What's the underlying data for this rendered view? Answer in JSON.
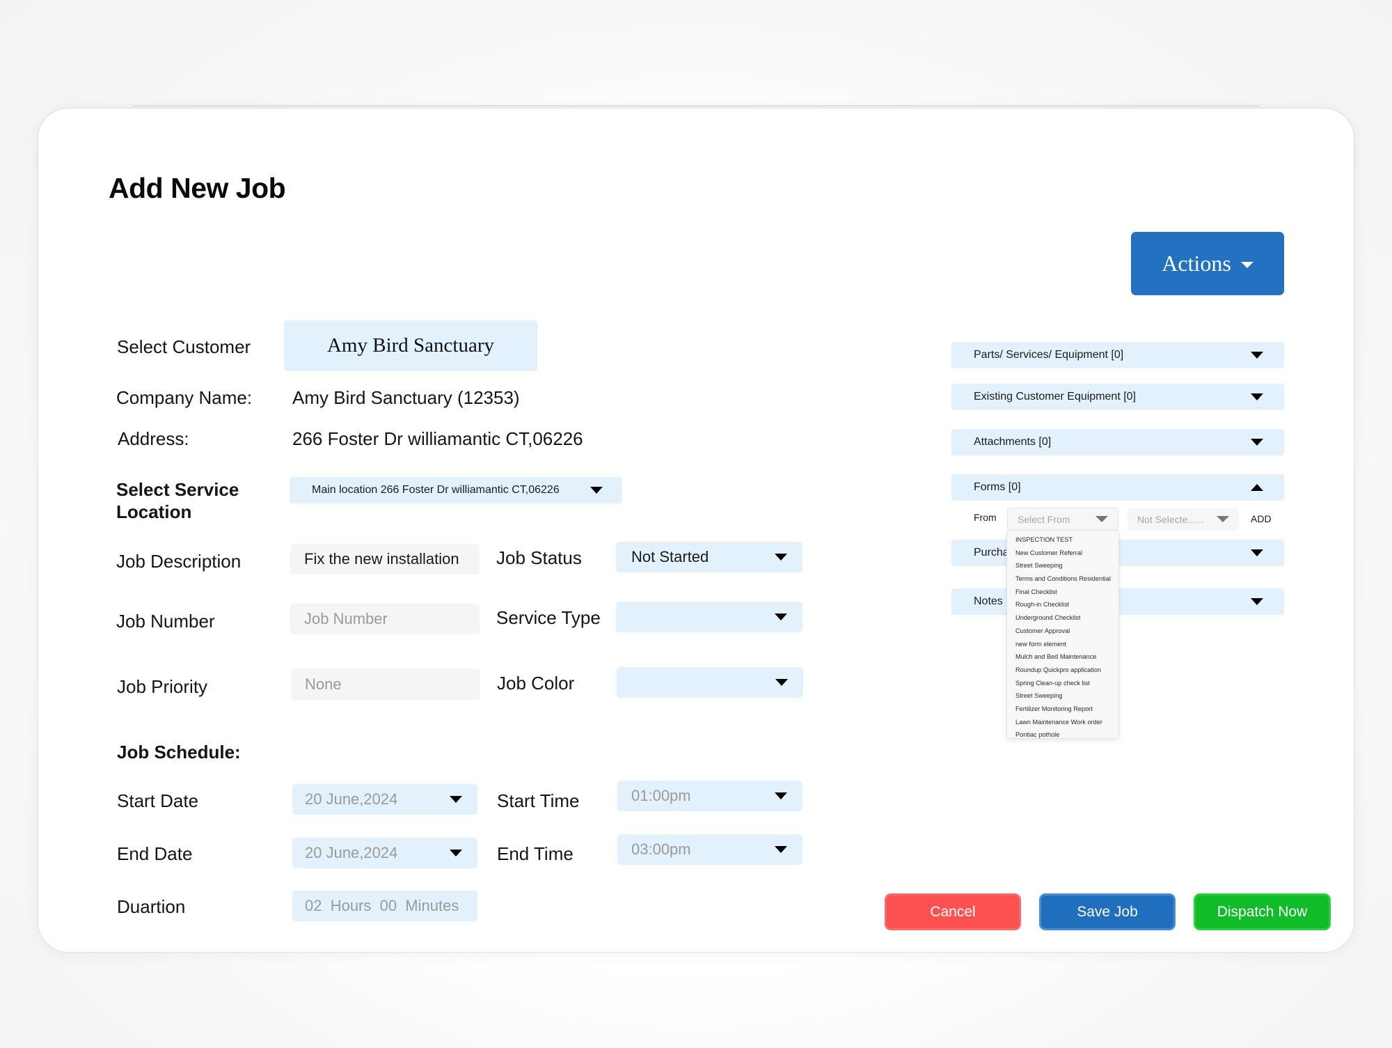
{
  "dialog": {
    "title": "Add New Job",
    "actions_label": "Actions"
  },
  "customer": {
    "select_label": "Select Customer",
    "selected": "Amy Bird Sanctuary",
    "company_label": "Company Name:",
    "company_value": "Amy Bird Sanctuary (12353)",
    "address_label": "Address:",
    "address_value": "266 Foster Dr williamantic CT,06226"
  },
  "service_location": {
    "label_line1": "Select Service",
    "label_line2": "Location",
    "value": "Main location 266 Foster Dr williamantic CT,06226"
  },
  "job": {
    "description_label": "Job Description",
    "description_value": "Fix the new installation",
    "status_label": "Job Status",
    "status_value": "Not Started",
    "number_label": "Job Number",
    "number_placeholder": "Job Number",
    "service_type_label": "Service Type",
    "service_type_value": "",
    "priority_label": "Job Priority",
    "priority_placeholder": "None",
    "color_label": "Job Color",
    "color_value": ""
  },
  "schedule": {
    "heading": "Job Schedule:",
    "start_date_label": "Start Date",
    "start_date_value": "20 June,2024",
    "end_date_label": "End Date",
    "end_date_value": "20 June,2024",
    "start_time_label": "Start Time",
    "start_time_value": "01:00pm",
    "end_time_label": "End Time",
    "end_time_value": "03:00pm",
    "duration_label": "Duartion",
    "duration_value": "02  Hours  00  Minutes"
  },
  "side_panels": {
    "parts": "Parts/ Services/ Equipment [0]",
    "equipment": "Existing Customer Equipment [0]",
    "attachments": "Attachments [0]",
    "forms": "Forms [0]",
    "purchase": "Purcha",
    "notes": "Notes"
  },
  "forms": {
    "from_label": "From",
    "select_from_placeholder": "Select From",
    "not_selected_placeholder": "Not Selecte......",
    "add_label": "ADD",
    "dropdown_items": [
      "INSPECTION TEST",
      "New Customer Referral",
      "Street Sweeping",
      "Terms and Conditions Residential",
      "Final Checklist",
      "Rough-in Checklist",
      "Underground Checklist",
      "Customer Approval",
      "new form element",
      "Mulch and Bed Maintenance",
      "Roundup Quickpro application",
      "Spring Clean-up check list",
      "Street Sweeping",
      "Fertilizer Monitoring Report",
      "Lawn Maintenance Work order",
      "Pontiac pothole"
    ]
  },
  "footer": {
    "cancel": "Cancel",
    "save": "Save Job",
    "dispatch": "Dispatch Now"
  },
  "colors": {
    "primary": "#2372c2",
    "cancel": "#fd5050",
    "dispatch": "#10bc28",
    "field_bg": "#e3f1fc"
  }
}
